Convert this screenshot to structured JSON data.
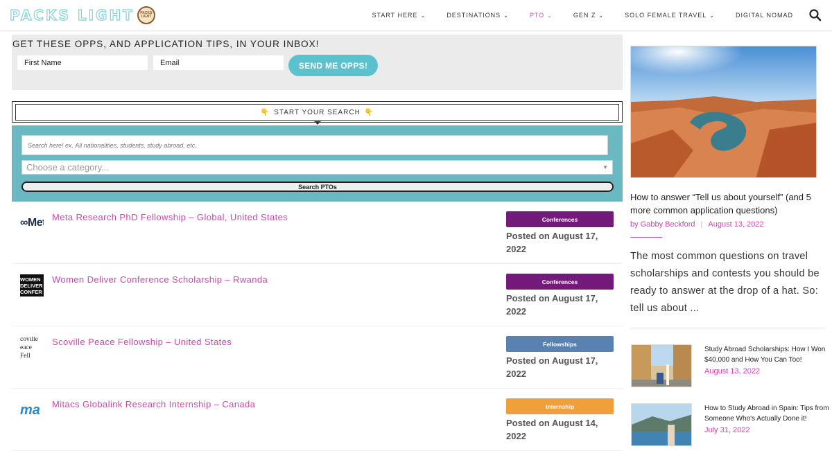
{
  "header": {
    "logo_text": "PACKS LIGHT",
    "nav": [
      {
        "label": "START HERE",
        "has_dropdown": true,
        "active": false
      },
      {
        "label": "DESTINATIONS",
        "has_dropdown": true,
        "active": false
      },
      {
        "label": "PTO",
        "has_dropdown": true,
        "active": true
      },
      {
        "label": "GEN Z",
        "has_dropdown": true,
        "active": false
      },
      {
        "label": "SOLO FEMALE TRAVEL",
        "has_dropdown": true,
        "active": false
      },
      {
        "label": "DIGITAL NOMAD",
        "has_dropdown": false,
        "active": false
      }
    ]
  },
  "newsletter": {
    "title": "GET THESE OPPS, AND APPLICATION TIPS, IN YOUR INBOX!",
    "first_name_placeholder": "First Name",
    "email_placeholder": "Email",
    "button_label": "SEND ME OPPS!"
  },
  "search": {
    "header_label": "START YOUR SEARCH",
    "hand_glyph": "👇",
    "input_placeholder": "Search here! ex. All nationalities, students, study abroad, etc.",
    "category_placeholder": "Choose a category...",
    "button_label": "Search PTOs"
  },
  "listings": [
    {
      "thumb_text": "∞Met",
      "title": "Meta Research PhD Fellowship – Global, United States",
      "badge": "Conferences",
      "badge_color": "#731a7a",
      "posted": "Posted on August 17, 2022"
    },
    {
      "thumb_text": "WOMEN DELIVER CONFER",
      "title": "Women Deliver Conference Scholarship – Rwanda",
      "badge": "Conferences",
      "badge_color": "#731a7a",
      "posted": "Posted on August 17, 2022"
    },
    {
      "thumb_text": "coville eace Fell",
      "title": "Scoville Peace Fellowship – United States",
      "badge": "Fellowships",
      "badge_color": "#5a82b0",
      "posted": "Posted on August 17, 2022"
    },
    {
      "thumb_text": "ma",
      "title": "Mitacs Globalink Research Internship – Canada",
      "badge": "Internship",
      "badge_color": "#f0a03a",
      "posted": "Posted on August 14, 2022"
    }
  ],
  "sidebar": {
    "featured": {
      "title": "How to answer “Tell us about yourself” (and 5 more common application questions)",
      "author": "by Gabby Beckford",
      "date": "August 13, 2022",
      "excerpt": "The most common questions on travel scholarships and contests you should be ready to answer at the drop of a hat. So: tell us about ..."
    },
    "posts": [
      {
        "title": "Study Abroad Scholarships: How I Won $40,000 and How You Can Too!",
        "date": "August 13, 2022"
      },
      {
        "title": "How to Study Abroad in Spain: Tips from Someone Who's Actually Done it!",
        "date": "July 31, 2022"
      }
    ]
  }
}
